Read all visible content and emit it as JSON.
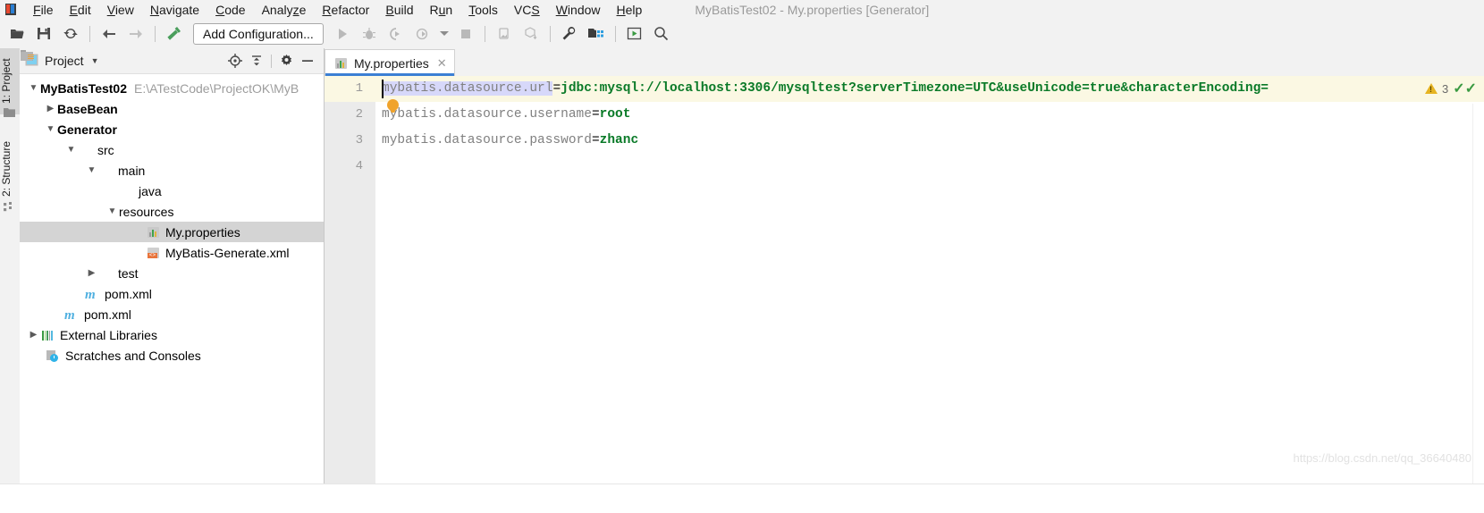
{
  "window": {
    "title": "MyBatisTest02 - My.properties [Generator]",
    "logo_icon": "intellij-idea-logo-icon"
  },
  "menubar": {
    "items": [
      {
        "label": "File",
        "mnemonic": "F"
      },
      {
        "label": "Edit",
        "mnemonic": "E"
      },
      {
        "label": "View",
        "mnemonic": "V"
      },
      {
        "label": "Navigate",
        "mnemonic": "N"
      },
      {
        "label": "Code",
        "mnemonic": "C"
      },
      {
        "label": "Analyze",
        "mnemonic": "z"
      },
      {
        "label": "Refactor",
        "mnemonic": "R"
      },
      {
        "label": "Build",
        "mnemonic": "B"
      },
      {
        "label": "Run",
        "mnemonic": "u"
      },
      {
        "label": "Tools",
        "mnemonic": "T"
      },
      {
        "label": "VCS",
        "mnemonic": "S"
      },
      {
        "label": "Window",
        "mnemonic": "W"
      },
      {
        "label": "Help",
        "mnemonic": "H"
      }
    ]
  },
  "toolbar": {
    "add_configuration_label": "Add Configuration...",
    "icons": [
      "open-folder-icon",
      "save-all-icon",
      "sync-refresh-icon",
      "back-arrow-icon",
      "forward-arrow-icon",
      "build-hammer-icon",
      "run-play-icon",
      "debug-bug-icon",
      "run-with-coverage-icon",
      "profiler-icon",
      "stop-icon",
      "device-manager-icon",
      "sync-gradle-icon",
      "settings-wrench-icon",
      "project-structure-icon",
      "run-anything-icon",
      "search-everywhere-icon"
    ]
  },
  "left_tool_strip": {
    "tabs": [
      {
        "label": "1: Project",
        "mnemonic": "1",
        "selected": true,
        "icon": "project-folder-icon"
      },
      {
        "label": "2: Structure",
        "mnemonic": "2",
        "selected": false,
        "icon": "structure-icon"
      }
    ]
  },
  "project_panel": {
    "title": "Project",
    "dropdown_icon": "chevron-down-icon",
    "view_icon": "project-view-icon",
    "actions": [
      {
        "name": "scroll-from-source-icon"
      },
      {
        "name": "collapse-all-icon"
      },
      {
        "name": "settings-gear-icon"
      },
      {
        "name": "hide-panel-icon"
      }
    ],
    "tree": [
      {
        "label": "MyBatisTest02",
        "secondary": "E:\\ATestCode\\ProjectOK\\MyB",
        "depth": 0,
        "arrow": "down",
        "icon": "module-folder-icon",
        "bold": true,
        "selected": false
      },
      {
        "label": "BaseBean",
        "secondary": "",
        "depth": 1,
        "arrow": "right",
        "icon": "module-folder-icon",
        "bold": true,
        "selected": false
      },
      {
        "label": "Generator",
        "secondary": "",
        "depth": 1,
        "arrow": "down",
        "icon": "module-folder-icon",
        "bold": true,
        "selected": false
      },
      {
        "label": "src",
        "secondary": "",
        "depth": 2,
        "arrow": "down",
        "icon": "folder-icon",
        "bold": false,
        "selected": false
      },
      {
        "label": "main",
        "secondary": "",
        "depth": 3,
        "arrow": "down",
        "icon": "folder-icon",
        "bold": false,
        "selected": false
      },
      {
        "label": "java",
        "secondary": "",
        "depth": 4,
        "arrow": "none",
        "icon": "source-folder-icon",
        "bold": false,
        "selected": false
      },
      {
        "label": "resources",
        "secondary": "",
        "depth": 4,
        "arrow": "down",
        "icon": "resources-folder-icon",
        "bold": false,
        "selected": false
      },
      {
        "label": "My.properties",
        "secondary": "",
        "depth": 5,
        "arrow": "none",
        "icon": "properties-file-icon",
        "bold": false,
        "selected": true
      },
      {
        "label": "MyBatis-Generate.xml",
        "secondary": "",
        "depth": 5,
        "arrow": "none",
        "icon": "xml-file-icon",
        "bold": false,
        "selected": false
      },
      {
        "label": "test",
        "secondary": "",
        "depth": 3,
        "arrow": "right",
        "icon": "folder-icon",
        "bold": false,
        "selected": false
      },
      {
        "label": "pom.xml",
        "secondary": "",
        "depth": 3,
        "arrow": "none",
        "icon": "maven-file-icon",
        "bold": false,
        "selected": false
      },
      {
        "label": "pom.xml",
        "secondary": "",
        "depth": 2,
        "arrow": "none",
        "icon": "maven-file-icon",
        "bold": false,
        "selected": false
      },
      {
        "label": "External Libraries",
        "secondary": "",
        "depth": 1,
        "arrow": "right",
        "icon": "external-libraries-icon",
        "bold": false,
        "selected": false
      },
      {
        "label": "Scratches and Consoles",
        "secondary": "",
        "depth": 1,
        "arrow": "none",
        "icon": "scratches-icon",
        "bold": false,
        "selected": false
      }
    ]
  },
  "editor": {
    "tab": {
      "label": "My.properties",
      "icon": "properties-file-icon",
      "close_icon": "close-icon"
    },
    "gutter_lines": [
      "1",
      "2",
      "3",
      "4"
    ],
    "current_line": 1,
    "lines": [
      {
        "number": "1",
        "key": "mybatis.datasource.url",
        "eq": "=",
        "value": "jdbc:mysql://localhost:3306/mysqltest?serverTimezone=UTC&useUnicode=true&characterEncoding=",
        "key_selected": true
      },
      {
        "number": "2",
        "key": "mybatis.datasource.username",
        "eq": "=",
        "value": "root",
        "key_selected": false
      },
      {
        "number": "3",
        "key": "mybatis.datasource.password",
        "eq": "=",
        "value": "zhanc",
        "key_selected": false
      },
      {
        "number": "4",
        "key": "",
        "eq": "",
        "value": "",
        "key_selected": false
      }
    ],
    "intention_bulb_icon": "intention-bulb-icon",
    "inspection": {
      "warning_count": "3",
      "warning_icon": "warning-triangle-icon",
      "ok_icon": "inspections-ok-check-icon"
    }
  },
  "watermark": {
    "text": "https://blog.csdn.net/qq_36640480"
  },
  "colors": {
    "accent": "#3b7fd4",
    "value_green": "#0a7a28",
    "key_gray": "#808080",
    "warning_yellow": "#e6b422",
    "ok_green": "#3a9a42",
    "selection_lavender": "#d7d8fa",
    "current_line_cream": "#fbf8e3",
    "chrome_gray": "#f2f2f2"
  }
}
